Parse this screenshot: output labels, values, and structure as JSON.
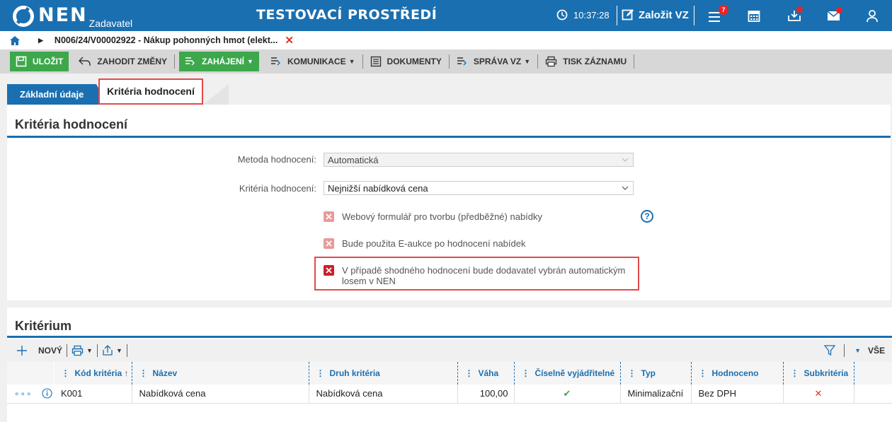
{
  "header": {
    "logo_text": "NEN",
    "logo_sub": "Zadavatel",
    "env_title": "TESTOVACÍ PROSTŘEDÍ",
    "time": "10:37:28",
    "create_label": "Založit VZ",
    "notifications_count": "7",
    "icons": [
      "clock-icon",
      "edit-icon",
      "menu-icon",
      "calendar-icon",
      "inbox-icon",
      "mail-icon",
      "user-icon"
    ]
  },
  "breadcrumb": {
    "item": "N006/24/V00002922 - Nákup pohonných hmot (elekt...",
    "close": "✕"
  },
  "toolbar": {
    "save": "ULOŽIT",
    "discard": "ZAHODIT ZMĚNY",
    "start": "ZAHÁJENÍ",
    "communication": "KOMUNIKACE",
    "documents": "DOKUMENTY",
    "manage": "SPRÁVA VZ",
    "print": "TISK ZÁZNAMU"
  },
  "tabs": {
    "basic": "Základní údaje",
    "criteria": "Kritéria hodnocení"
  },
  "criteria_panel": {
    "title": "Kritéria hodnocení",
    "method_label": "Metoda hodnocení:",
    "method_value": "Automatická",
    "criteria_label": "Kritéria hodnocení:",
    "criteria_value": "Nejnižší nabídková cena",
    "cb_webform": "Webový formulář pro tvorbu (předběžné) nabídky",
    "cb_eauction": "Bude použita E-aukce po hodnocení nabídek",
    "cb_lot_line1": "V případě shodného hodnocení bude dodavatel vybrán automatickým",
    "cb_lot_line2": "losem v NEN",
    "help": "?"
  },
  "kriterium_panel": {
    "title": "Kritérium",
    "new": "NOVÝ",
    "all": "VŠE",
    "columns": {
      "code": "Kód kritéria",
      "name": "Název",
      "kind": "Druh kritéria",
      "weight": "Váha",
      "numeric": "Číselně vyjádřitelné",
      "type": "Typ",
      "evaluated": "Hodnoceno",
      "sub": "Subkritéria"
    },
    "rows": [
      {
        "code": "K001",
        "name": "Nabídková cena",
        "kind": "Nabídková cena",
        "weight": "100,00",
        "numeric": "✔",
        "type": "Minimalizační",
        "evaluated": "Bez DPH",
        "sub": "✕"
      }
    ]
  },
  "colors": {
    "primary": "#1a6fb0",
    "green": "#3da74b",
    "red": "#e24a4a"
  }
}
